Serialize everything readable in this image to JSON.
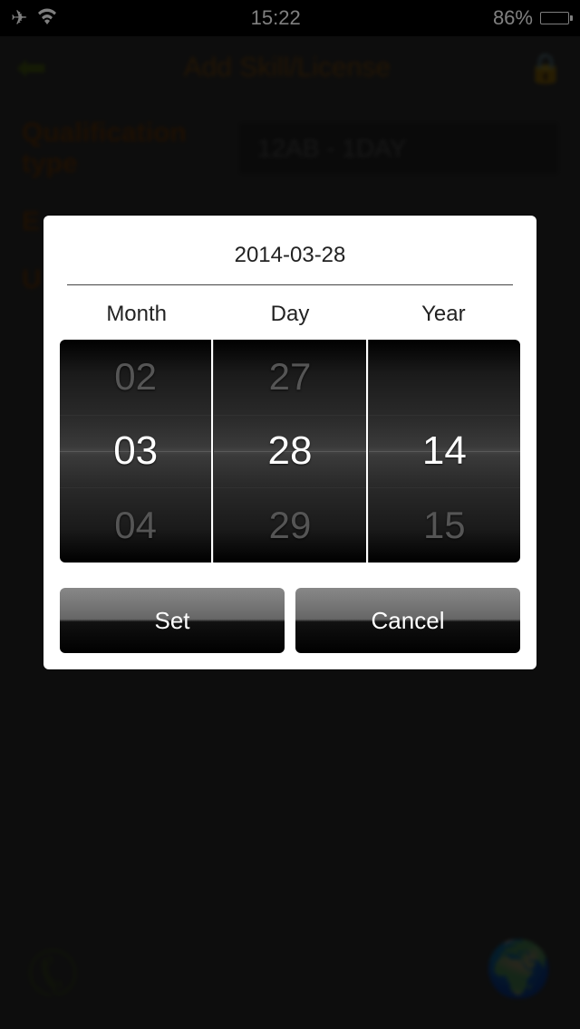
{
  "status": {
    "time": "15:22",
    "battery_percent": "86%"
  },
  "background": {
    "title": "Add Skill/License",
    "qualification_label": "Qualification type",
    "qualification_value": "12AB - 1DAY",
    "row2_label": "E",
    "row3_label": "U"
  },
  "picker": {
    "date_string": "2014-03-28",
    "labels": {
      "month": "Month",
      "day": "Day",
      "year": "Year"
    },
    "month": {
      "prev": "02",
      "current": "03",
      "next": "04"
    },
    "day": {
      "prev": "27",
      "current": "28",
      "next": "29"
    },
    "year": {
      "prev": "",
      "current": "14",
      "next": "15"
    },
    "buttons": {
      "set": "Set",
      "cancel": "Cancel"
    }
  }
}
